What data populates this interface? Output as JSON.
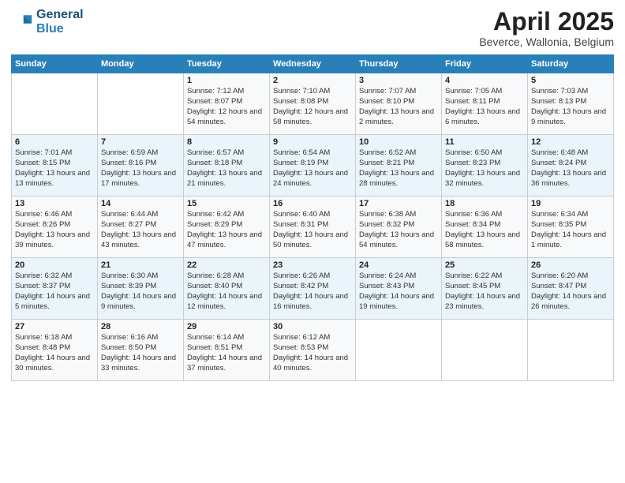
{
  "header": {
    "logo_general": "General",
    "logo_blue": "Blue",
    "month_title": "April 2025",
    "subtitle": "Beverce, Wallonia, Belgium"
  },
  "days_header": [
    "Sunday",
    "Monday",
    "Tuesday",
    "Wednesday",
    "Thursday",
    "Friday",
    "Saturday"
  ],
  "weeks": [
    [
      {
        "day": "",
        "info": ""
      },
      {
        "day": "",
        "info": ""
      },
      {
        "day": "1",
        "info": "Sunrise: 7:12 AM\nSunset: 8:07 PM\nDaylight: 12 hours and 54 minutes."
      },
      {
        "day": "2",
        "info": "Sunrise: 7:10 AM\nSunset: 8:08 PM\nDaylight: 12 hours and 58 minutes."
      },
      {
        "day": "3",
        "info": "Sunrise: 7:07 AM\nSunset: 8:10 PM\nDaylight: 13 hours and 2 minutes."
      },
      {
        "day": "4",
        "info": "Sunrise: 7:05 AM\nSunset: 8:11 PM\nDaylight: 13 hours and 6 minutes."
      },
      {
        "day": "5",
        "info": "Sunrise: 7:03 AM\nSunset: 8:13 PM\nDaylight: 13 hours and 9 minutes."
      }
    ],
    [
      {
        "day": "6",
        "info": "Sunrise: 7:01 AM\nSunset: 8:15 PM\nDaylight: 13 hours and 13 minutes."
      },
      {
        "day": "7",
        "info": "Sunrise: 6:59 AM\nSunset: 8:16 PM\nDaylight: 13 hours and 17 minutes."
      },
      {
        "day": "8",
        "info": "Sunrise: 6:57 AM\nSunset: 8:18 PM\nDaylight: 13 hours and 21 minutes."
      },
      {
        "day": "9",
        "info": "Sunrise: 6:54 AM\nSunset: 8:19 PM\nDaylight: 13 hours and 24 minutes."
      },
      {
        "day": "10",
        "info": "Sunrise: 6:52 AM\nSunset: 8:21 PM\nDaylight: 13 hours and 28 minutes."
      },
      {
        "day": "11",
        "info": "Sunrise: 6:50 AM\nSunset: 8:23 PM\nDaylight: 13 hours and 32 minutes."
      },
      {
        "day": "12",
        "info": "Sunrise: 6:48 AM\nSunset: 8:24 PM\nDaylight: 13 hours and 36 minutes."
      }
    ],
    [
      {
        "day": "13",
        "info": "Sunrise: 6:46 AM\nSunset: 8:26 PM\nDaylight: 13 hours and 39 minutes."
      },
      {
        "day": "14",
        "info": "Sunrise: 6:44 AM\nSunset: 8:27 PM\nDaylight: 13 hours and 43 minutes."
      },
      {
        "day": "15",
        "info": "Sunrise: 6:42 AM\nSunset: 8:29 PM\nDaylight: 13 hours and 47 minutes."
      },
      {
        "day": "16",
        "info": "Sunrise: 6:40 AM\nSunset: 8:31 PM\nDaylight: 13 hours and 50 minutes."
      },
      {
        "day": "17",
        "info": "Sunrise: 6:38 AM\nSunset: 8:32 PM\nDaylight: 13 hours and 54 minutes."
      },
      {
        "day": "18",
        "info": "Sunrise: 6:36 AM\nSunset: 8:34 PM\nDaylight: 13 hours and 58 minutes."
      },
      {
        "day": "19",
        "info": "Sunrise: 6:34 AM\nSunset: 8:35 PM\nDaylight: 14 hours and 1 minute."
      }
    ],
    [
      {
        "day": "20",
        "info": "Sunrise: 6:32 AM\nSunset: 8:37 PM\nDaylight: 14 hours and 5 minutes."
      },
      {
        "day": "21",
        "info": "Sunrise: 6:30 AM\nSunset: 8:39 PM\nDaylight: 14 hours and 9 minutes."
      },
      {
        "day": "22",
        "info": "Sunrise: 6:28 AM\nSunset: 8:40 PM\nDaylight: 14 hours and 12 minutes."
      },
      {
        "day": "23",
        "info": "Sunrise: 6:26 AM\nSunset: 8:42 PM\nDaylight: 14 hours and 16 minutes."
      },
      {
        "day": "24",
        "info": "Sunrise: 6:24 AM\nSunset: 8:43 PM\nDaylight: 14 hours and 19 minutes."
      },
      {
        "day": "25",
        "info": "Sunrise: 6:22 AM\nSunset: 8:45 PM\nDaylight: 14 hours and 23 minutes."
      },
      {
        "day": "26",
        "info": "Sunrise: 6:20 AM\nSunset: 8:47 PM\nDaylight: 14 hours and 26 minutes."
      }
    ],
    [
      {
        "day": "27",
        "info": "Sunrise: 6:18 AM\nSunset: 8:48 PM\nDaylight: 14 hours and 30 minutes."
      },
      {
        "day": "28",
        "info": "Sunrise: 6:16 AM\nSunset: 8:50 PM\nDaylight: 14 hours and 33 minutes."
      },
      {
        "day": "29",
        "info": "Sunrise: 6:14 AM\nSunset: 8:51 PM\nDaylight: 14 hours and 37 minutes."
      },
      {
        "day": "30",
        "info": "Sunrise: 6:12 AM\nSunset: 8:53 PM\nDaylight: 14 hours and 40 minutes."
      },
      {
        "day": "",
        "info": ""
      },
      {
        "day": "",
        "info": ""
      },
      {
        "day": "",
        "info": ""
      }
    ]
  ]
}
